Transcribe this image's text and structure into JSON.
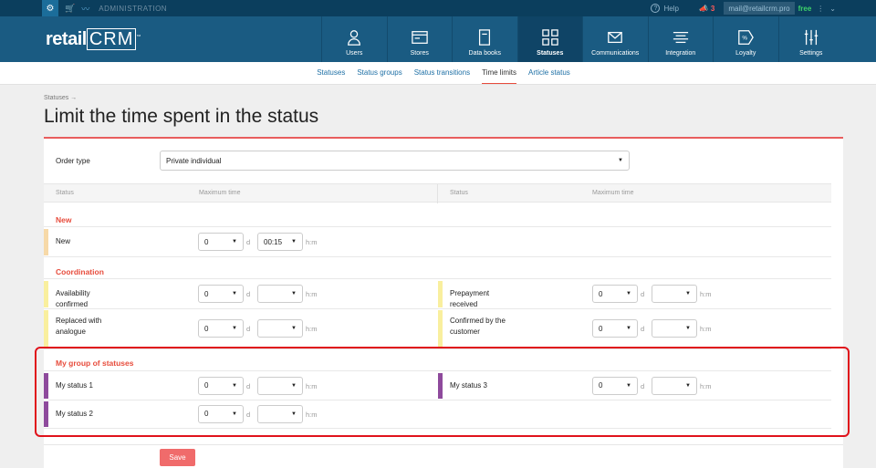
{
  "adminbar": {
    "label": "ADMINISTRATION",
    "help": "Help",
    "notifications": "3",
    "account": "mail@retailcrm.pro",
    "plan": "free"
  },
  "logo": {
    "retail": "retail",
    "crm": "CRM",
    "mark": "™"
  },
  "nav": [
    {
      "label": "Users",
      "icon": "user-icon"
    },
    {
      "label": "Stores",
      "icon": "store-icon"
    },
    {
      "label": "Data books",
      "icon": "book-icon"
    },
    {
      "label": "Statuses",
      "icon": "statuses-icon"
    },
    {
      "label": "Communications",
      "icon": "mail-icon"
    },
    {
      "label": "Integration",
      "icon": "integration-icon"
    },
    {
      "label": "Loyalty",
      "icon": "loyalty-icon"
    },
    {
      "label": "Settings",
      "icon": "sliders-icon"
    }
  ],
  "subnav": [
    "Statuses",
    "Status groups",
    "Status transitions",
    "Time limits",
    "Article status"
  ],
  "breadcrumb": "Statuses →",
  "title": "Limit the time spent in the status",
  "form": {
    "order_type_label": "Order type",
    "order_type_value": "Private individual",
    "col_status": "Status",
    "col_max_time": "Maximum time",
    "unit_d": "d",
    "unit_hm": "h:m"
  },
  "groups": [
    {
      "title": "New",
      "rows": [
        {
          "left": {
            "name": "New",
            "days": "0",
            "time": "00:15",
            "color": "#f7d9a8"
          }
        }
      ]
    },
    {
      "title": "Coordination",
      "rows": [
        {
          "left": {
            "name": "Availability confirmed",
            "days": "0",
            "time": "",
            "color": "#f9ef9e"
          },
          "right": {
            "name": "Prepayment received",
            "days": "0",
            "time": "",
            "color": "#f9ef9e"
          }
        },
        {
          "left": {
            "name": "Replaced with analogue",
            "days": "0",
            "time": "",
            "color": "#f9ef9e"
          },
          "right": {
            "name": "Confirmed by the customer",
            "days": "0",
            "time": "",
            "color": "#f9ef9e"
          }
        }
      ]
    },
    {
      "title": "My group of statuses",
      "rows": [
        {
          "left": {
            "name": "My status 1",
            "days": "0",
            "time": "",
            "color": "#8e4a9c"
          },
          "right": {
            "name": "My status 3",
            "days": "0",
            "time": "",
            "color": "#8e4a9c"
          }
        },
        {
          "left": {
            "name": "My status 2",
            "days": "0",
            "time": "",
            "color": "#8e4a9c"
          }
        }
      ]
    }
  ],
  "save_label": "Save"
}
